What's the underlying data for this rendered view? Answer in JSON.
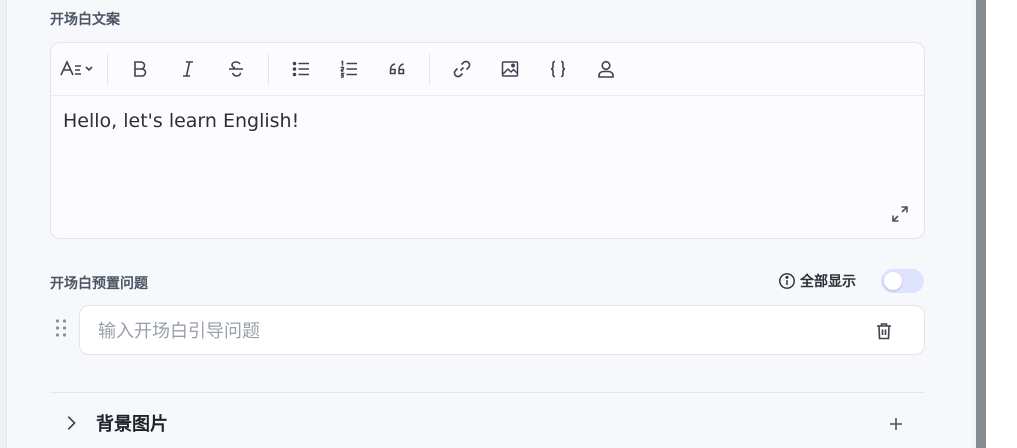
{
  "opening": {
    "title": "开场白文案",
    "content": "Hello, let's learn English!"
  },
  "toolbar": {
    "items": [
      "font-style-icon",
      "bold-icon",
      "italic-icon",
      "strikethrough-icon",
      "bullet-list-icon",
      "numbered-list-icon",
      "quote-icon",
      "link-icon",
      "image-icon",
      "code-braces-icon",
      "user-icon"
    ]
  },
  "preset": {
    "title": "开场白预置问题",
    "show_all_label": "全部显示",
    "show_all_enabled": false,
    "input_placeholder": "输入开场白引导问题"
  },
  "background": {
    "title": "背景图片"
  }
}
